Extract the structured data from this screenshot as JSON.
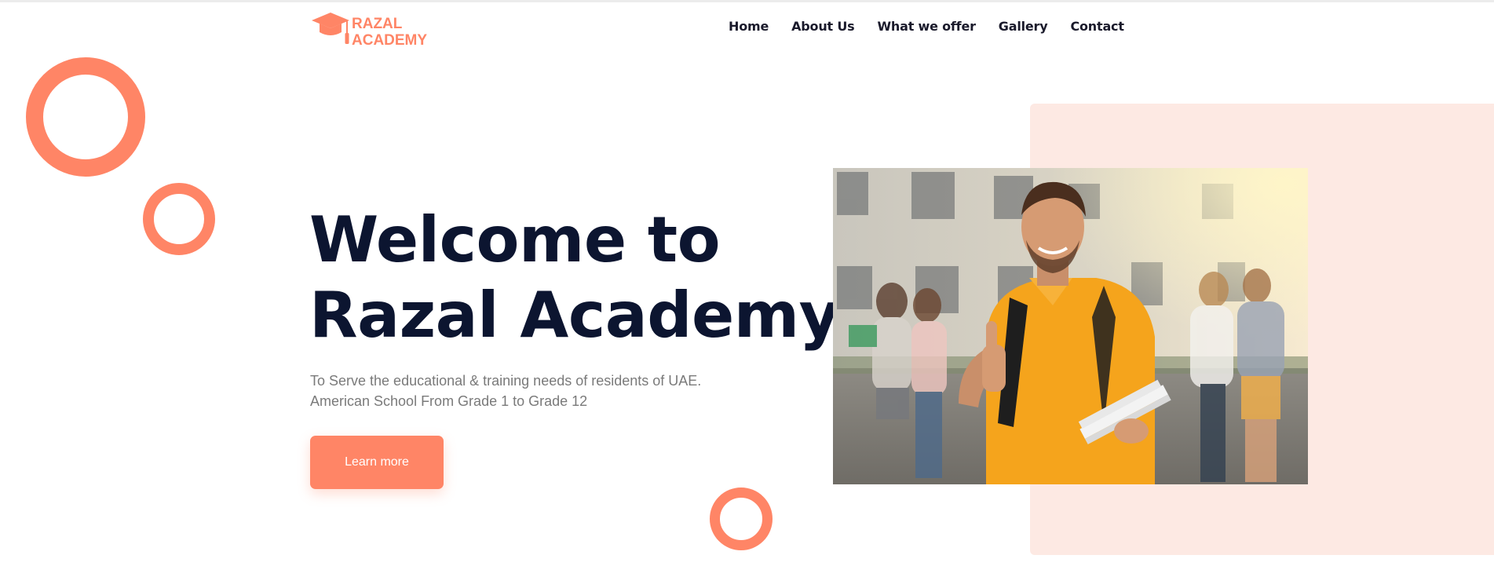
{
  "logo": {
    "line1": "RAZAL",
    "line2": "ACADEMY",
    "color": "#ff8566"
  },
  "nav": {
    "items": [
      {
        "label": "Home"
      },
      {
        "label": "About Us"
      },
      {
        "label": "What we offer"
      },
      {
        "label": "Gallery"
      },
      {
        "label": "Contact"
      }
    ]
  },
  "hero": {
    "title_line1": "Welcome to",
    "title_line2": "Razal Academy",
    "subtitle_line1": "To Serve the educational & training needs of residents of UAE.",
    "subtitle_line2": "American School From Grade 1 to Grade 12",
    "button_label": "Learn more"
  },
  "colors": {
    "accent": "#ff8566",
    "heading": "#0c1530",
    "panel": "#fde9e3",
    "body_text": "#7a7a7a"
  },
  "icons": {
    "logo": "graduation-cap-icon",
    "photo": "student-thumbs-up-photo"
  }
}
